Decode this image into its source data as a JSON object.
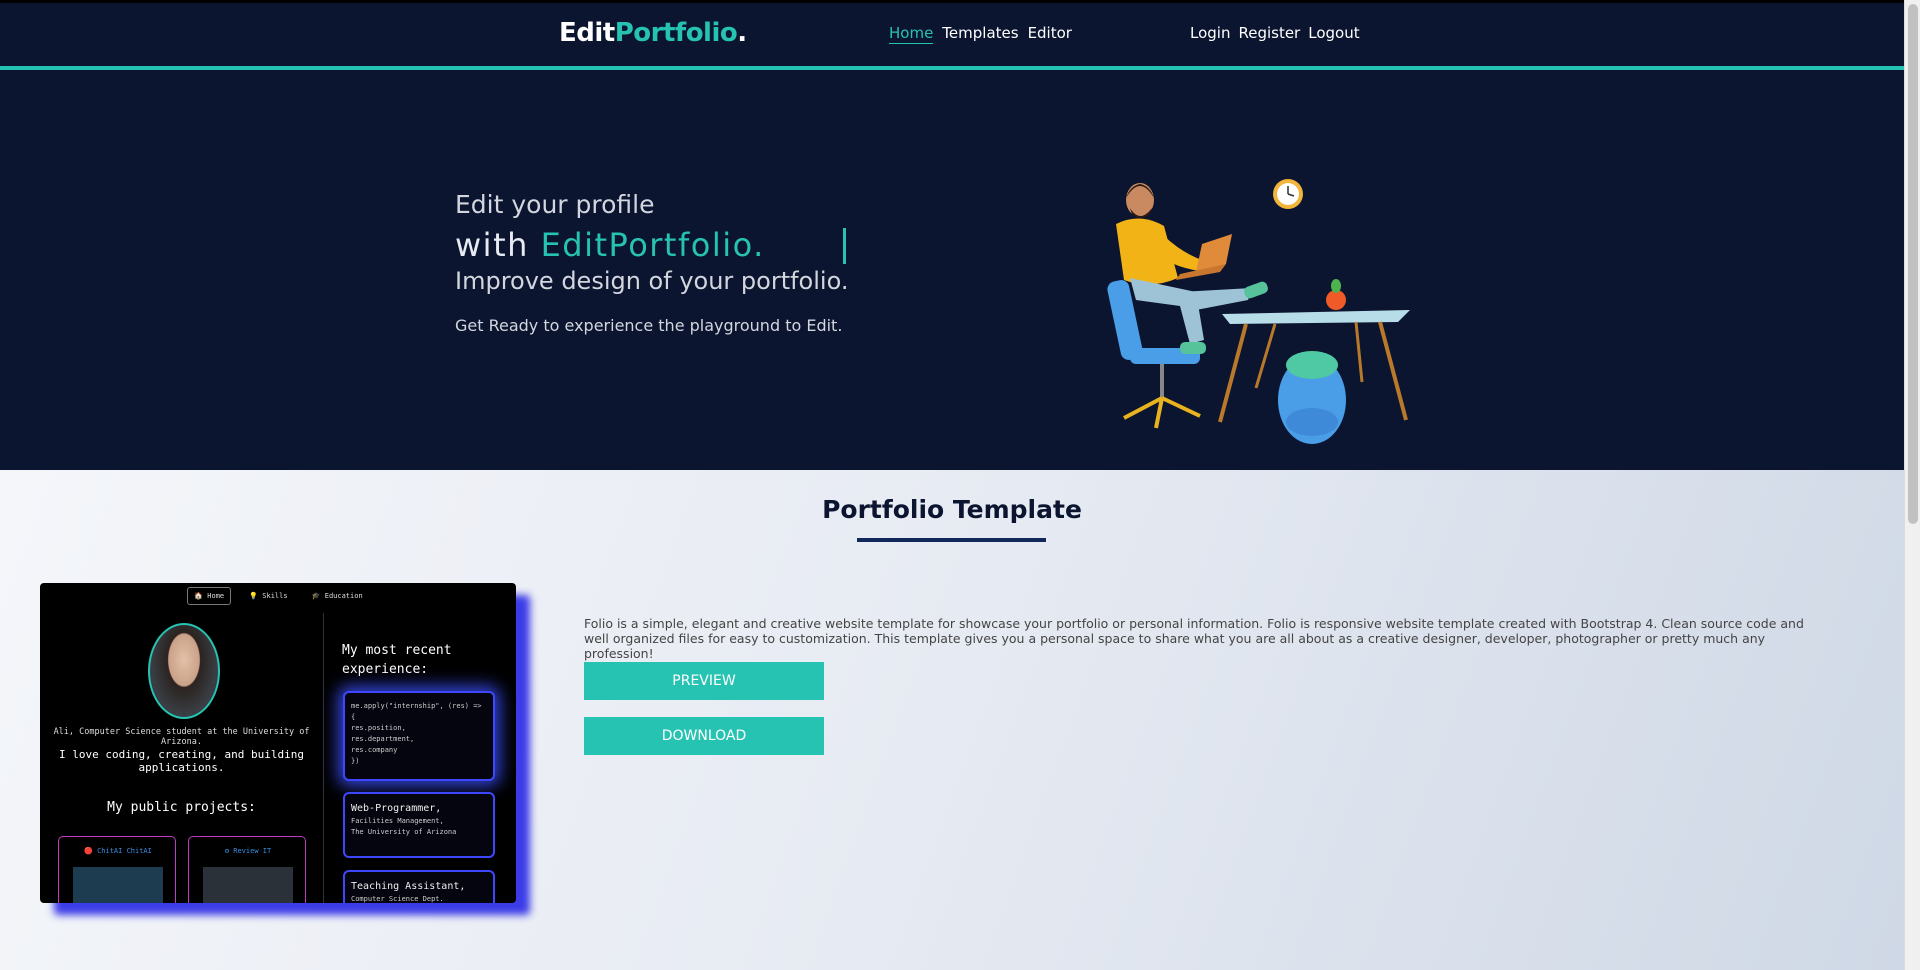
{
  "navbar": {
    "brand_part1": "Edit",
    "brand_part2": "Portfolio",
    "brand_part3": ".",
    "links": [
      "Home",
      "Templates",
      "Editor"
    ],
    "auth": [
      "Login",
      "Register",
      "Logout"
    ]
  },
  "hero": {
    "line1": "Edit your profile",
    "line2_prefix": "with ",
    "line2_highlight": "EditPortfolio.",
    "line3": "Improve design of your portfolio.",
    "line4": "Get Ready to experience the playground to Edit."
  },
  "section": {
    "title": "Portfolio Template",
    "description": "Folio is a simple, elegant and creative website template for showcase your portfolio or personal information. Folio is responsive website template created with Bootstrap 4. Clean source code and well organized files for easy to customization. This template gives you a personal space to share what you are all about as a creative designer, developer, photographer or pretty much any profession!",
    "preview_label": "PREVIEW",
    "download_label": "DOWNLOAD"
  },
  "template_preview": {
    "nav": [
      "🏠 Home",
      "💡 Skills",
      "🎓 Education"
    ],
    "intro": "Ali, Computer Science student at the University of Arizona.",
    "love": "I love coding, creating, and building applications.",
    "projects_heading": "My public projects:",
    "projects": [
      "🔴 ChitAI ChitAI",
      "⚙ Review IT"
    ],
    "recent_heading": "My most recent experience:",
    "code_lines": [
      "me.apply(\"internship\", (res) => {",
      "res.position,",
      "res.department,",
      "res.company",
      "})"
    ],
    "exp2_title": "Web-Programmer,",
    "exp2_lines": [
      "Facilities Management,",
      "The University of Arizona"
    ],
    "exp3_title": "Teaching Assistant,",
    "exp3_line": "Computer Science Dept."
  },
  "colors": {
    "accent": "#26c3b2",
    "navy": "#0b1530",
    "glow": "#3d47ff"
  }
}
